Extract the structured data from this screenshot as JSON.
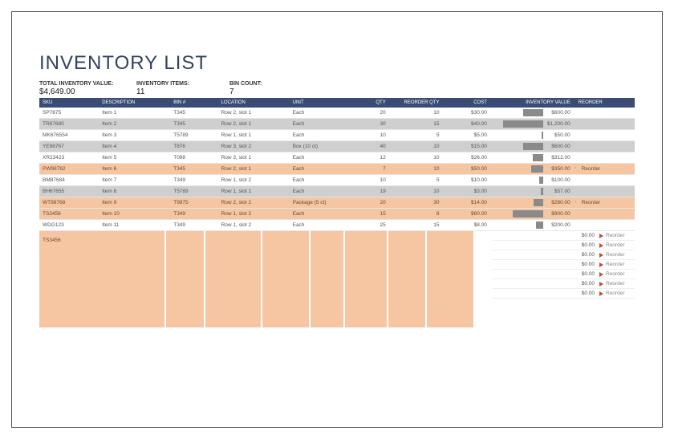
{
  "title": "INVENTORY LIST",
  "summary": {
    "total_label": "TOTAL INVENTORY VALUE:",
    "total_value": "$4,649.00",
    "items_label": "INVENTORY ITEMS:",
    "items_value": "11",
    "bins_label": "BIN COUNT:",
    "bins_value": "7"
  },
  "headers": {
    "sku": "SKU",
    "desc": "DESCRIPTION",
    "bin": "BIN #",
    "loc": "LOCATION",
    "unit": "UNIT",
    "qty": "QTY",
    "rqty": "REORDER QTY",
    "cost": "COST",
    "inv": "INVENTORY VALUE",
    "re": "REORDER"
  },
  "rows": [
    {
      "sku": "SP7875",
      "desc": "Item 1",
      "bin": "T345",
      "loc": "Row 2, slot 1",
      "unit": "Each",
      "qty": "20",
      "rqty": "10",
      "cost": "$30.00",
      "inv": "$600.00",
      "bar": 45,
      "hl": false,
      "alt": false,
      "reorder": ""
    },
    {
      "sku": "TR87680",
      "desc": "Item 2",
      "bin": "T345",
      "loc": "Row 2, slot 1",
      "unit": "Each",
      "qty": "30",
      "rqty": "15",
      "cost": "$40.00",
      "inv": "$1,200.00",
      "bar": 90,
      "hl": false,
      "alt": true,
      "reorder": ""
    },
    {
      "sku": "MK676554",
      "desc": "Item 3",
      "bin": "T5789",
      "loc": "Row 1, slot 1",
      "unit": "Each",
      "qty": "10",
      "rqty": "5",
      "cost": "$5.00",
      "inv": "$50.00",
      "bar": 4,
      "hl": false,
      "alt": false,
      "reorder": ""
    },
    {
      "sku": "YE98767",
      "desc": "Item 4",
      "bin": "T876",
      "loc": "Row 3, slot 2",
      "unit": "Box (10 ct)",
      "qty": "40",
      "rqty": "10",
      "cost": "$15.00",
      "inv": "$600.00",
      "bar": 45,
      "hl": false,
      "alt": true,
      "reorder": ""
    },
    {
      "sku": "XR23423",
      "desc": "Item 5",
      "bin": "T098",
      "loc": "Row 3, slot 1",
      "unit": "Each",
      "qty": "12",
      "rqty": "10",
      "cost": "$26.00",
      "inv": "$312.00",
      "bar": 24,
      "hl": false,
      "alt": false,
      "reorder": ""
    },
    {
      "sku": "PW98762",
      "desc": "Item 6",
      "bin": "T345",
      "loc": "Row 2, slot 1",
      "unit": "Each",
      "qty": "7",
      "rqty": "10",
      "cost": "$50.00",
      "inv": "$350.00",
      "bar": 27,
      "hl": true,
      "alt": false,
      "reorder": "Reorder"
    },
    {
      "sku": "BM87684",
      "desc": "Item 7",
      "bin": "T349",
      "loc": "Row 1, slot 2",
      "unit": "Each",
      "qty": "10",
      "rqty": "5",
      "cost": "$10.00",
      "inv": "$100.00",
      "bar": 8,
      "hl": false,
      "alt": false,
      "reorder": ""
    },
    {
      "sku": "BH67655",
      "desc": "Item 8",
      "bin": "T5789",
      "loc": "Row 1, slot 1",
      "unit": "Each",
      "qty": "19",
      "rqty": "10",
      "cost": "$3.00",
      "inv": "$57.00",
      "bar": 5,
      "hl": false,
      "alt": true,
      "reorder": ""
    },
    {
      "sku": "WT98768",
      "desc": "Item 9",
      "bin": "T9875",
      "loc": "Row 2, slot 2",
      "unit": "Package (5 ct)",
      "qty": "20",
      "rqty": "30",
      "cost": "$14.00",
      "inv": "$280.00",
      "bar": 22,
      "hl": true,
      "alt": false,
      "reorder": "Reorder"
    },
    {
      "sku": "TS3456",
      "desc": "Item 10",
      "bin": "T349",
      "loc": "Row 1, slot 2",
      "unit": "Each",
      "qty": "15",
      "rqty": "8",
      "cost": "$60.00",
      "inv": "$900.00",
      "bar": 68,
      "hl": true,
      "alt": false,
      "reorder": ""
    },
    {
      "sku": "WDG123",
      "desc": "Item 11",
      "bin": "T349",
      "loc": "Row 1, slot 2",
      "unit": "Each",
      "qty": "25",
      "rqty": "15",
      "cost": "$8.00",
      "inv": "$200.00",
      "bar": 16,
      "hl": false,
      "alt": false,
      "reorder": ""
    }
  ],
  "tail_sku": "TS3456",
  "tail_rows": [
    {
      "val": "$0.00",
      "txt": "Reorder"
    },
    {
      "val": "$0.00",
      "txt": "Reorder"
    },
    {
      "val": "$0.00",
      "txt": "Reorder"
    },
    {
      "val": "$0.00",
      "txt": "Reorder"
    },
    {
      "val": "$0.00",
      "txt": "Reorder"
    },
    {
      "val": "$0.00",
      "txt": "Reorder"
    },
    {
      "val": "$0.00",
      "txt": "Reorder"
    }
  ],
  "chart_data": {
    "type": "table",
    "title": "INVENTORY LIST",
    "summary": {
      "total_inventory_value": 4649.0,
      "inventory_items": 11,
      "bin_count": 7
    },
    "columns": [
      "SKU",
      "DESCRIPTION",
      "BIN #",
      "LOCATION",
      "UNIT",
      "QTY",
      "REORDER QTY",
      "COST",
      "INVENTORY VALUE",
      "REORDER"
    ],
    "rows": [
      [
        "SP7875",
        "Item 1",
        "T345",
        "Row 2, slot 1",
        "Each",
        20,
        10,
        30.0,
        600.0,
        ""
      ],
      [
        "TR87680",
        "Item 2",
        "T345",
        "Row 2, slot 1",
        "Each",
        30,
        15,
        40.0,
        1200.0,
        ""
      ],
      [
        "MK676554",
        "Item 3",
        "T5789",
        "Row 1, slot 1",
        "Each",
        10,
        5,
        5.0,
        50.0,
        ""
      ],
      [
        "YE98767",
        "Item 4",
        "T876",
        "Row 3, slot 2",
        "Box (10 ct)",
        40,
        10,
        15.0,
        600.0,
        ""
      ],
      [
        "XR23423",
        "Item 5",
        "T098",
        "Row 3, slot 1",
        "Each",
        12,
        10,
        26.0,
        312.0,
        ""
      ],
      [
        "PW98762",
        "Item 6",
        "T345",
        "Row 2, slot 1",
        "Each",
        7,
        10,
        50.0,
        350.0,
        "Reorder"
      ],
      [
        "BM87684",
        "Item 7",
        "T349",
        "Row 1, slot 2",
        "Each",
        10,
        5,
        10.0,
        100.0,
        ""
      ],
      [
        "BH67655",
        "Item 8",
        "T5789",
        "Row 1, slot 1",
        "Each",
        19,
        10,
        3.0,
        57.0,
        ""
      ],
      [
        "WT98768",
        "Item 9",
        "T9875",
        "Row 2, slot 2",
        "Package (5 ct)",
        20,
        30,
        14.0,
        280.0,
        "Reorder"
      ],
      [
        "TS3456",
        "Item 10",
        "T349",
        "Row 1, slot 2",
        "Each",
        15,
        8,
        60.0,
        900.0,
        ""
      ],
      [
        "WDG123",
        "Item 11",
        "T349",
        "Row 1, slot 2",
        "Each",
        25,
        15,
        8.0,
        200.0,
        ""
      ]
    ]
  }
}
